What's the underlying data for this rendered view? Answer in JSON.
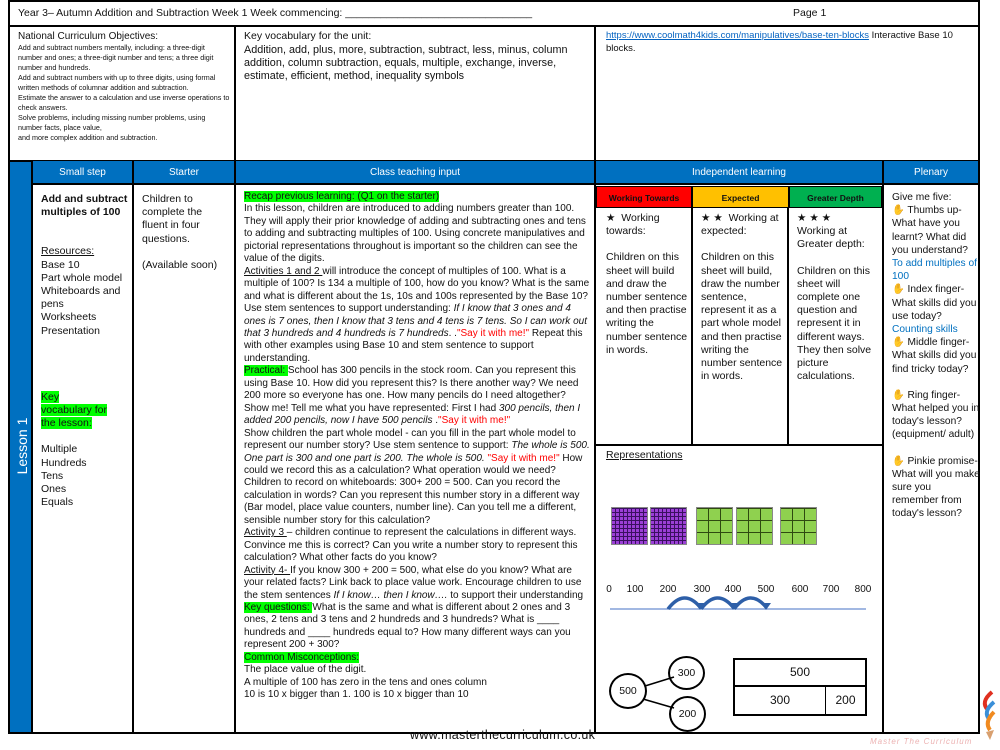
{
  "header": {
    "title": "Year 3– Autumn Addition and Subtraction Week 1   Week  commencing: ________________________________",
    "page": "Page 1"
  },
  "objectives": {
    "heading": "National Curriculum Objectives:",
    "lines": [
      "Add and subtract numbers mentally, including: a three-digit number and ones; a three-digit number and tens; a three digit number and hundreds.",
      "Add and subtract numbers with up to three digits, using formal written methods of columnar addition and subtraction.",
      "Estimate the answer to a calculation and use inverse operations to check answers.",
      "Solve problems, including missing number problems, using number facts, place value,",
      "and more complex addition and subtraction."
    ]
  },
  "vocab_unit": {
    "heading": "Key vocabulary for the unit:",
    "text": "Addition, add, plus, more, subtraction,  subtract, less, minus, column addition, column subtraction, equals, multiple, exchange, inverse, estimate, efficient, method, inequality symbols"
  },
  "resource_link": {
    "url": "https://www.coolmath4kids.com/manipulatives/base-ten-blocks",
    "text": " Interactive Base 10 blocks."
  },
  "columns": {
    "small_step": "Small step",
    "starter": "Starter",
    "class": "Class teaching input",
    "independent": "Independent learning",
    "plenary": "Plenary"
  },
  "lesson_label": "Lesson 1",
  "small_step": {
    "title": "Add and subtract multiples of 100",
    "resources_heading": "Resources:",
    "resources": [
      "Base 10",
      "Part whole model",
      "Whiteboards and pens",
      "Worksheets",
      "Presentation"
    ],
    "vocab_heading": "Key vocabulary for the lesson:",
    "vocab": [
      "Multiple",
      "Hundreds",
      "Tens",
      "Ones",
      "Equals"
    ]
  },
  "starter": {
    "text": "Children to complete the fluent in four questions.",
    "note": "(Available soon)"
  },
  "teaching": [
    [
      [
        "hl",
        "Recap previous learning: (Q1 on the starter)"
      ]
    ],
    [
      [
        "",
        "In this lesson, children are introduced to adding numbers greater than 100. They will apply their prior knowledge of adding and subtracting ones and tens to adding and subtracting multiples of 100. Using concrete manipulatives and pictorial representations throughout is important so the children can see the value of the digits."
      ]
    ],
    [
      [
        "u",
        "Activities 1 and 2 "
      ],
      [
        "",
        "will introduce the concept of multiples of 100.  What is a multiple of 100?  Is 134 a multiple of 100, how do you know?  What is the same and what is different about the 1s, 10s and 100s represented by the Base 10? Use stem sentences to support understanding: "
      ],
      [
        "i",
        "If I  know that 3 ones and 4 ones is 7 ones, then I know that 3 tens and 4 tens is 7 tens. So I can work out that 3 hundreds and 4 hundreds is 7 hundreds"
      ],
      [
        "",
        ". ."
      ],
      [
        "red",
        "\"Say it with me!\""
      ],
      [
        "",
        "  Repeat this with other examples using Base 10 and stem sentence to support understanding."
      ]
    ],
    [
      [
        "hl",
        "Practical: "
      ],
      [
        "",
        "School has 300 pencils in the stock room.  Can you represent this using Base 10. How did you represent this?  Is there another way?  We need 200 more so everyone has one.  How many pencils do I need altogether?  Show me!  Tell me what you have represented: First I had "
      ],
      [
        "i",
        " 300 pencils, then I added 200 pencils, now I  have 500 pencils "
      ],
      [
        "",
        "."
      ],
      [
        "red",
        "\"Say it with me!\""
      ]
    ],
    [
      [
        "",
        "Show children the part whole model  - can you fill in the part whole model to represent our number story?  Use stem sentence to support: "
      ],
      [
        "i",
        "The whole is 500. One part is 300 and one part is 200. The whole is 500. "
      ],
      [
        "red",
        "\"Say it with me!\""
      ],
      [
        "",
        " How could we record this as a calculation? What operation would we need? Children to record on whiteboards: 300+ 200 = 500.  Can you record the calculation in words? Can you represent this number story in a different way (Bar model, place value counters, number line). Can you tell me a  different, sensible number story for this calculation?"
      ]
    ],
    [
      [
        "u",
        "Activity 3 "
      ],
      [
        "",
        "– children continue to represent the calculations in different ways. Convince me this is correct? Can you write a number story to represent this calculation?  What other facts do you know?"
      ]
    ],
    [
      [
        "u",
        "Activity 4- "
      ],
      [
        "",
        "If you know 300 + 200 = 500, what else do you know?  What are your related facts? Link back to place value work.  Encourage children to use the stem sentences "
      ],
      [
        "i",
        "If I know… then I know…."
      ],
      [
        "",
        "  to support their understanding"
      ]
    ],
    [
      [
        "hl",
        " Key questions:  "
      ],
      [
        "",
        " What is the same and what is different about 2 ones and 3 ones, 2 tens and 3 tens and 2 hundreds and 3 hundreds? What is ____ hundreds and ____ hundreds equal to? How many different ways can you represent 200 + 300?"
      ]
    ],
    [
      [
        "hl",
        "Common Misconceptions:"
      ]
    ],
    [
      [
        "",
        "The place value of the digit."
      ]
    ],
    [
      [
        "",
        " A multiple of 100 has zero in the tens and ones column"
      ]
    ],
    [
      [
        "",
        "10 is 10 x bigger than 1.  100 is 10 x bigger than 10"
      ]
    ]
  ],
  "independent": {
    "levels": [
      {
        "label": "Working Towards",
        "color": "#ff0000",
        "stars": "★",
        "heading": "Working towards:",
        "text": "Children on this sheet will build and draw the number sentence and then practise writing the number sentence in words."
      },
      {
        "label": "Expected",
        "color": "#ffc000",
        "stars": "★ ★",
        "heading": "Working at expected:",
        "text": "Children on this sheet will build, draw the number sentence, represent it as a part whole model and then practise writing the number sentence in words."
      },
      {
        "label": "Greater Depth",
        "color": "#00b050",
        "stars": "★ ★ ★",
        "heading": "Working at Greater depth:",
        "text": "Children on this sheet will complete one question and represent it in different ways. They then solve picture calculations."
      }
    ],
    "representations_heading": "Representations",
    "base10": {
      "hundreds_purple": 2,
      "hundreds_green": 3
    },
    "number_line": {
      "labels": [
        "0",
        "100",
        "200",
        "300",
        "400",
        "500",
        "600",
        "700",
        "800"
      ],
      "jumps_from": [
        200,
        300,
        400
      ],
      "jump_size": 100
    },
    "part_whole": {
      "whole": "500",
      "parts": [
        "300",
        "200"
      ]
    },
    "bar_model": {
      "whole": "500",
      "parts": [
        "300",
        "200"
      ]
    }
  },
  "plenary": {
    "intro": "Give me five:",
    "items": [
      {
        "text": "Thumbs up- What have you learnt? What did you understand?",
        "answer": "To add multiples of 100"
      },
      {
        "text": "Index finger- What skills did you use today?",
        "answer": "Counting skills"
      },
      {
        "text": "Middle finger- What skills did you find tricky today?",
        "answer": ""
      },
      {
        "text": "Ring finger- What helped you in today's lesson? (equipment/ adult)",
        "answer": ""
      },
      {
        "text": "Pinkie promise- What will you make sure you remember from today's lesson?",
        "answer": ""
      }
    ]
  },
  "footer": {
    "url": "www.masterthecurriculum.co.uk",
    "logo_text": "Master The Curriculum"
  }
}
